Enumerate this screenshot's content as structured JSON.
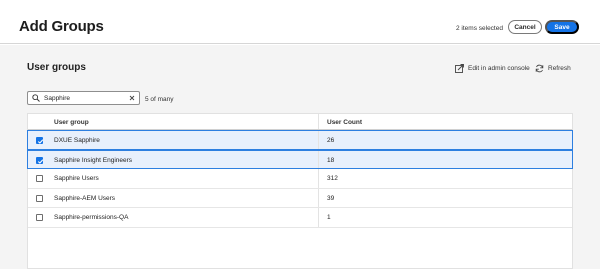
{
  "header": {
    "title": "Add Groups",
    "selection_status": "2 items selected",
    "cancel_label": "Cancel",
    "save_label": "Save",
    "save_color": "#1473e6"
  },
  "section": {
    "title": "User groups",
    "edit_label": "Edit in admin console",
    "refresh_label": "Refresh"
  },
  "search": {
    "value": "Sapphire",
    "count_text": "5 of many"
  },
  "table": {
    "columns": [
      "User group",
      "User Count"
    ],
    "rows": [
      {
        "name": "DXUE Sapphire",
        "count": "26",
        "selected": true
      },
      {
        "name": "Sapphire Insight Engineers",
        "count": "18",
        "selected": true
      },
      {
        "name": "Sapphire Users",
        "count": "312",
        "selected": false
      },
      {
        "name": "Sapphire-AEM Users",
        "count": "39",
        "selected": false
      },
      {
        "name": "Sapphire-permissions-QA",
        "count": "1",
        "selected": false
      }
    ]
  }
}
